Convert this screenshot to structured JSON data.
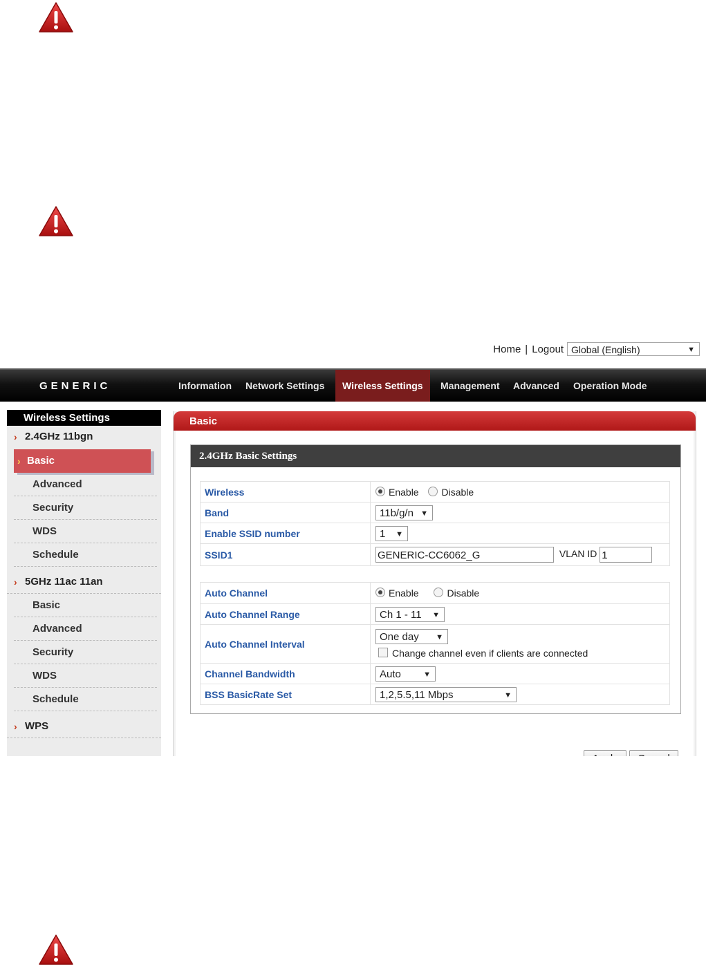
{
  "header": {
    "home_link": "Home",
    "logout_link": "Logout",
    "separator": "|",
    "language_selected": "Global (English)"
  },
  "nav": {
    "logo": "GENERIC",
    "items": [
      "Information",
      "Network Settings",
      "Wireless Settings",
      "Management",
      "Advanced",
      "Operation Mode"
    ],
    "active": "Wireless Settings"
  },
  "sidebar": {
    "title": "Wireless Settings",
    "group1": "2.4GHz 11bgn",
    "group1_items": [
      "Basic",
      "Advanced",
      "Security",
      "WDS",
      "Schedule"
    ],
    "group2": "5GHz 11ac 11an",
    "group2_items": [
      "Basic",
      "Advanced",
      "Security",
      "WDS",
      "Schedule"
    ],
    "group3": "WPS",
    "active_item": "Basic"
  },
  "panel": {
    "title": "Basic",
    "section_title": "2.4GHz Basic Settings"
  },
  "settings": {
    "wireless": {
      "label": "Wireless",
      "enable": "Enable",
      "disable": "Disable",
      "selected": "Enable"
    },
    "band": {
      "label": "Band",
      "value": "11b/g/n"
    },
    "ssid_number": {
      "label": "Enable SSID number",
      "value": "1"
    },
    "ssid1": {
      "label": "SSID1",
      "value": "GENERIC-CC6062_G",
      "vlan_label": "VLAN ID",
      "vlan_value": "1"
    },
    "auto_channel": {
      "label": "Auto Channel",
      "enable": "Enable",
      "disable": "Disable",
      "selected": "Enable"
    },
    "auto_channel_range": {
      "label": "Auto Channel Range",
      "value": "Ch 1 - 11"
    },
    "auto_channel_interval": {
      "label": "Auto Channel Interval",
      "value": "One day",
      "checkbox_label": "Change channel even if clients are connected",
      "checked": false
    },
    "channel_bandwidth": {
      "label": "Channel Bandwidth",
      "value": "Auto"
    },
    "bss_basic_rate_set": {
      "label": "BSS BasicRate Set",
      "value": "1,2,5.5,11 Mbps"
    }
  },
  "buttons": {
    "apply": "Apply",
    "cancel": "Cancel"
  },
  "icons": {
    "warning": "warning-triangle-icon",
    "dropdown": "dropdown-arrow-icon",
    "chevron": "chevron-right-icon"
  },
  "colors": {
    "accent_red": "#c42020",
    "nav_active": "#7a1d1d",
    "label_blue": "#2a5aa6"
  }
}
